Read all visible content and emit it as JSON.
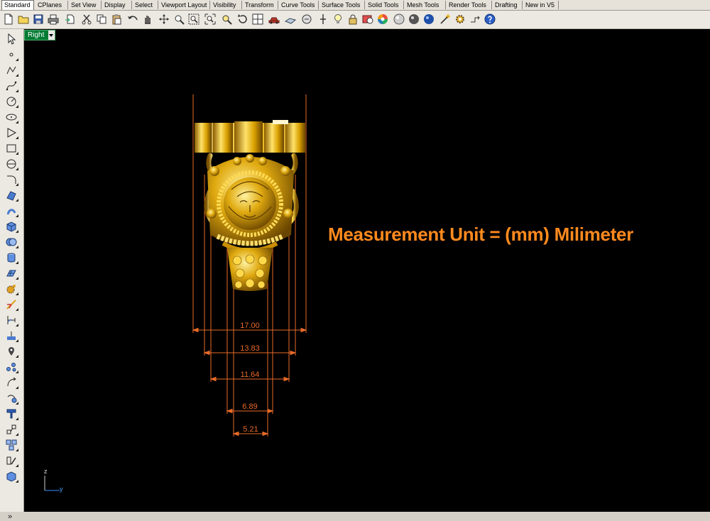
{
  "tabs": [
    {
      "label": "Standard",
      "active": true
    },
    {
      "label": "CPlanes"
    },
    {
      "label": "Set View"
    },
    {
      "label": "Display"
    },
    {
      "label": "Select"
    },
    {
      "label": "Viewport Layout"
    },
    {
      "label": "Visibility"
    },
    {
      "label": "Transform"
    },
    {
      "label": "Curve Tools"
    },
    {
      "label": "Surface Tools"
    },
    {
      "label": "Solid Tools"
    },
    {
      "label": "Mesh Tools"
    },
    {
      "label": "Render Tools"
    },
    {
      "label": "Drafting"
    },
    {
      "label": "New in V5"
    }
  ],
  "toolbar_icons": [
    "new-file-icon",
    "open-folder-icon",
    "save-icon",
    "print-icon",
    "import-icon",
    "cut-icon",
    "copy-icon",
    "paste-icon",
    "undo-icon",
    "pan-hand-icon",
    "pan-arrows-icon",
    "zoom-icon",
    "zoom-window-icon",
    "zoom-extents-icon",
    "zoom-selected-icon",
    "rotate-view-icon",
    "viewport-grid-icon",
    "car-icon",
    "set-cplane-icon",
    "orient-icon",
    "pin-icon",
    "lightbulb-icon",
    "lock-icon",
    "shaded-sphere-icon",
    "color-wheel-icon",
    "rendered-sphere-icon",
    "render-icon",
    "wand-icon",
    "options-gear-icon",
    "grid-snap-icon",
    "help-icon"
  ],
  "side_icons": [
    "select-arrow-icon",
    "point-icon",
    "polyline-icon",
    "curve-icon",
    "circle-icon",
    "ellipse-icon",
    "polygon-icon",
    "rectangle-icon",
    "offset-icon",
    "fillet-icon",
    "surface-icon",
    "sweep-icon",
    "box-icon",
    "boolean-icon",
    "cylinder-icon",
    "mesh-icon",
    "explode-icon",
    "trim-icon",
    "dimension-icon",
    "analyze-icon",
    "group-icon",
    "curve-edit-icon",
    "text-icon",
    "transform-icon",
    "array-icon",
    "block-icon",
    "render-box-icon"
  ],
  "viewport": {
    "name": "Right",
    "caption": "Measurement Unit = (mm) Milimeter",
    "axis_z": "z",
    "axis_y": "y"
  },
  "dimensions": [
    "17.00",
    "13.83",
    "11.64",
    "6.89",
    "5.21"
  ],
  "colors": {
    "viewport_bg": "#000000",
    "dimension": "#e96a28",
    "caption": "#ff8a1e",
    "gold_light": "#ffe680",
    "gold_mid": "#d9a300",
    "gold_dark": "#7a5200"
  }
}
